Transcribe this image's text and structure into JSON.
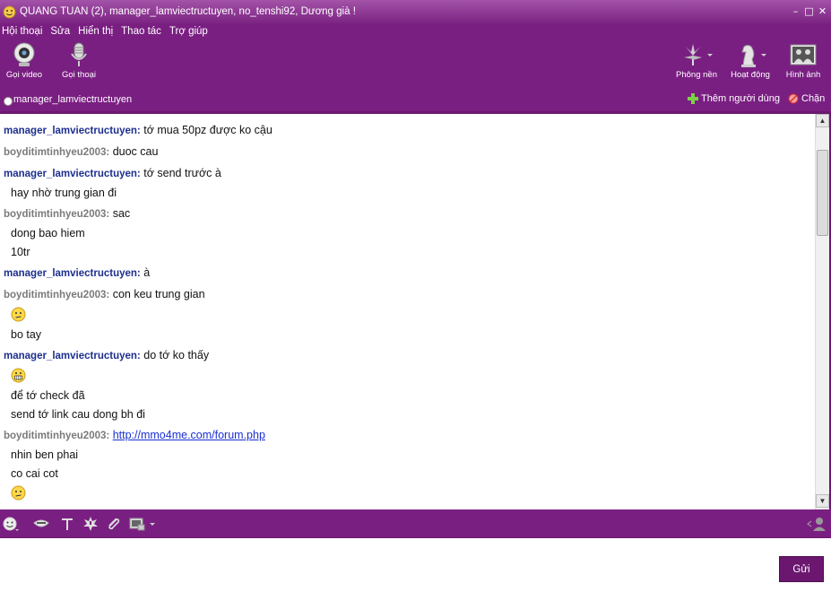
{
  "window": {
    "title": "QUANG TUAN (2), manager_lamviectructuyen, no_tenshi92, Dương già !",
    "accent": "#7a1f82"
  },
  "menu": [
    "Hội thoại",
    "Sửa",
    "Hiển thị",
    "Thao tác",
    "Trợ giúp"
  ],
  "toolbar": {
    "video_call": "Gọi video",
    "voice_call": "Gọi thoại",
    "background": "Phông nền",
    "activity": "Hoạt động",
    "photos": "Hình ảnh"
  },
  "conversation": {
    "contact": "manager_lamviectructuyen",
    "add_user": "Thêm người dùng",
    "block": "Chặn"
  },
  "messages": [
    {
      "sender": "manager_lamviectructuyen:",
      "text": "tớ mua 50pz được ko cậu"
    },
    {
      "sender": "boyditimtinhyeu2003:",
      "text": "duoc cau"
    },
    {
      "sender": "manager_lamviectructuyen:",
      "text": "tớ send trước à"
    },
    {
      "cont": "hay nhờ trung gian đi"
    },
    {
      "sender": "boyditimtinhyeu2003:",
      "text": "sac"
    },
    {
      "cont": "dong bao hiem"
    },
    {
      "cont": "10tr"
    },
    {
      "sender": "manager_lamviectructuyen:",
      "text": "à"
    },
    {
      "sender": "boyditimtinhyeu2003:",
      "text": "con keu trung gian"
    },
    {
      "emoticon": "worried-emoticon"
    },
    {
      "cont": "bo tay"
    },
    {
      "sender": "manager_lamviectructuyen:",
      "text": "do tớ ko thấy"
    },
    {
      "emoticon": "grin-emoticon"
    },
    {
      "cont": "để tớ check đã"
    },
    {
      "cont": "send tớ link cau dong bh đi"
    },
    {
      "sender": "boyditimtinhyeu2003:",
      "link": "http://mmo4me.com/forum.php"
    },
    {
      "cont": "nhin ben phai"
    },
    {
      "cont": "co cai cot"
    },
    {
      "emoticon": "worried-emoticon"
    }
  ],
  "send_button": "Gửi"
}
